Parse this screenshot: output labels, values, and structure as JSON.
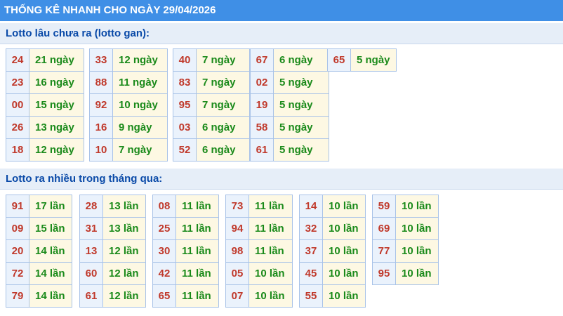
{
  "title": "THỐNG KÊ NHANH CHO NGÀY 29/04/2026",
  "gan_heading": "Lotto lâu chưa ra (lotto gan):",
  "gan_groups": [
    [
      {
        "num": "24",
        "val": "21 ngày"
      },
      {
        "num": "23",
        "val": "16 ngày"
      },
      {
        "num": "00",
        "val": "15 ngày"
      },
      {
        "num": "26",
        "val": "13 ngày"
      },
      {
        "num": "18",
        "val": "12 ngày"
      }
    ],
    [
      {
        "num": "33",
        "val": "12 ngày"
      },
      {
        "num": "88",
        "val": "11 ngày"
      },
      {
        "num": "92",
        "val": "10 ngày"
      },
      {
        "num": "16",
        "val": "9 ngày"
      },
      {
        "num": "10",
        "val": "7 ngày"
      }
    ],
    [
      {
        "num": "40",
        "val": "7 ngày"
      },
      {
        "num": "83",
        "val": "7 ngày"
      },
      {
        "num": "95",
        "val": "7 ngày"
      },
      {
        "num": "03",
        "val": "6 ngày"
      },
      {
        "num": "52",
        "val": "6 ngày"
      }
    ],
    [
      {
        "num": "67",
        "val": "6 ngày"
      },
      {
        "num": "02",
        "val": "5 ngày"
      },
      {
        "num": "19",
        "val": "5 ngày"
      },
      {
        "num": "58",
        "val": "5 ngày"
      },
      {
        "num": "61",
        "val": "5 ngày"
      }
    ],
    [
      {
        "num": "65",
        "val": "5 ngày"
      }
    ]
  ],
  "freq_heading": "Lotto ra nhiều trong tháng qua:",
  "freq_groups": [
    [
      {
        "num": "91",
        "val": "17 lần"
      },
      {
        "num": "09",
        "val": "15 lần"
      },
      {
        "num": "20",
        "val": "14 lần"
      },
      {
        "num": "72",
        "val": "14 lần"
      },
      {
        "num": "79",
        "val": "14 lần"
      }
    ],
    [
      {
        "num": "28",
        "val": "13 lần"
      },
      {
        "num": "31",
        "val": "13 lần"
      },
      {
        "num": "13",
        "val": "12 lần"
      },
      {
        "num": "60",
        "val": "12 lần"
      },
      {
        "num": "61",
        "val": "12 lần"
      }
    ],
    [
      {
        "num": "08",
        "val": "11 lần"
      },
      {
        "num": "25",
        "val": "11 lần"
      },
      {
        "num": "30",
        "val": "11 lần"
      },
      {
        "num": "42",
        "val": "11 lần"
      },
      {
        "num": "65",
        "val": "11 lần"
      }
    ],
    [
      {
        "num": "73",
        "val": "11 lần"
      },
      {
        "num": "94",
        "val": "11 lần"
      },
      {
        "num": "98",
        "val": "11 lần"
      },
      {
        "num": "05",
        "val": "10 lần"
      },
      {
        "num": "07",
        "val": "10 lần"
      }
    ],
    [
      {
        "num": "14",
        "val": "10 lần"
      },
      {
        "num": "32",
        "val": "10 lần"
      },
      {
        "num": "37",
        "val": "10 lần"
      },
      {
        "num": "45",
        "val": "10 lần"
      },
      {
        "num": "55",
        "val": "10 lần"
      }
    ],
    [
      {
        "num": "59",
        "val": "10 lần"
      },
      {
        "num": "69",
        "val": "10 lần"
      },
      {
        "num": "77",
        "val": "10 lần"
      },
      {
        "num": "95",
        "val": "10 lần"
      }
    ]
  ],
  "colors": {
    "title_bar": "#3f8fe6",
    "section_head_bg": "#e6eef8",
    "section_head_text": "#0a4aa8",
    "number_text": "#c0392b",
    "value_text": "#1a8a1a",
    "number_bg": "#eaf2fc",
    "value_bg": "#fdf8e3"
  }
}
